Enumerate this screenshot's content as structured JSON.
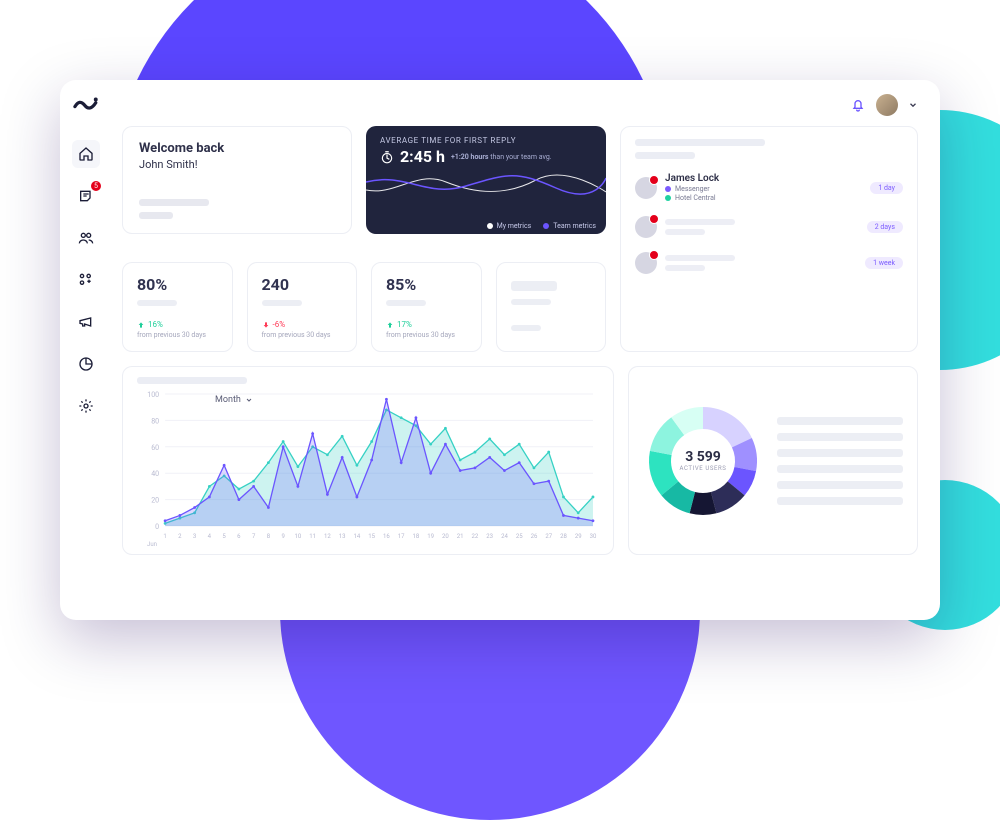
{
  "sidebar": {
    "items": [
      {
        "name": "home-icon",
        "active": true
      },
      {
        "name": "inbox-icon",
        "badge": "5"
      },
      {
        "name": "users-icon"
      },
      {
        "name": "apps-icon"
      },
      {
        "name": "megaphone-icon"
      },
      {
        "name": "chart-icon"
      },
      {
        "name": "gear-icon"
      }
    ]
  },
  "welcome": {
    "title": "Welcome back",
    "user": "John Smith!"
  },
  "reply_card": {
    "label": "AVERAGE TIME FOR FIRST REPLY",
    "value": "2:45 h",
    "delta": "+1:20 hours",
    "delta_suffix": "than your team avg.",
    "legend": {
      "my": "My metrics",
      "team": "Team metrics"
    }
  },
  "queue": {
    "entries": [
      {
        "name": "James Lock",
        "channel": "Messenger",
        "place": "Hotel Central",
        "pill": "1 day"
      },
      {
        "name": "",
        "channel": "",
        "place": "",
        "pill": "2 days"
      },
      {
        "name": "",
        "channel": "",
        "place": "",
        "pill": "1 week"
      }
    ]
  },
  "tiles": [
    {
      "value": "80%",
      "trend": "16%",
      "dir": "up",
      "prev": "from previous 30 days"
    },
    {
      "value": "240",
      "trend": "-6%",
      "dir": "down",
      "prev": "from previous 30 days"
    },
    {
      "value": "85%",
      "trend": "17%",
      "dir": "up",
      "prev": "from previous 30 days"
    },
    {
      "value": "",
      "trend": "",
      "dir": "",
      "prev": ""
    }
  ],
  "chart": {
    "selector": "Month",
    "ylabels": [
      "100",
      "80",
      "60",
      "40",
      "20",
      "0"
    ],
    "xstart": "1",
    "xend": "30",
    "xaxis_label": "Jun"
  },
  "donut": {
    "value": "3 599",
    "label": "ACTIVE USERS"
  },
  "chart_data": {
    "line_chart": {
      "type": "line",
      "xlabel": "Jun",
      "ylabel": "",
      "x": [
        1,
        2,
        3,
        4,
        5,
        6,
        7,
        8,
        9,
        10,
        11,
        12,
        13,
        14,
        15,
        16,
        17,
        18,
        19,
        20,
        21,
        22,
        23,
        24,
        25,
        26,
        27,
        28,
        29,
        30
      ],
      "ylim": [
        0,
        100
      ],
      "series": [
        {
          "name": "My metrics",
          "color": "#36d1c4",
          "values": [
            2,
            6,
            10,
            30,
            38,
            28,
            34,
            48,
            64,
            45,
            60,
            54,
            68,
            46,
            64,
            88,
            82,
            76,
            62,
            74,
            50,
            56,
            66,
            54,
            62,
            44,
            56,
            22,
            10,
            22
          ]
        },
        {
          "name": "Team metrics",
          "color": "#6b55ff",
          "values": [
            4,
            8,
            14,
            22,
            46,
            20,
            30,
            14,
            60,
            30,
            70,
            24,
            52,
            22,
            50,
            96,
            48,
            82,
            40,
            62,
            42,
            44,
            52,
            42,
            48,
            32,
            34,
            8,
            6,
            4
          ]
        }
      ]
    },
    "donut": {
      "type": "pie",
      "title": "Active users",
      "total": 3599,
      "slices": [
        {
          "color": "#d7d2ff",
          "value": 18
        },
        {
          "color": "#9f90ff",
          "value": 10
        },
        {
          "color": "#6b55ff",
          "value": 8
        },
        {
          "color": "#2d2d58",
          "value": 10
        },
        {
          "color": "#151633",
          "value": 8
        },
        {
          "color": "#17b9a4",
          "value": 10
        },
        {
          "color": "#2de3c0",
          "value": 14
        },
        {
          "color": "#8df4df",
          "value": 12
        },
        {
          "color": "#d7fff4",
          "value": 10
        }
      ]
    }
  }
}
